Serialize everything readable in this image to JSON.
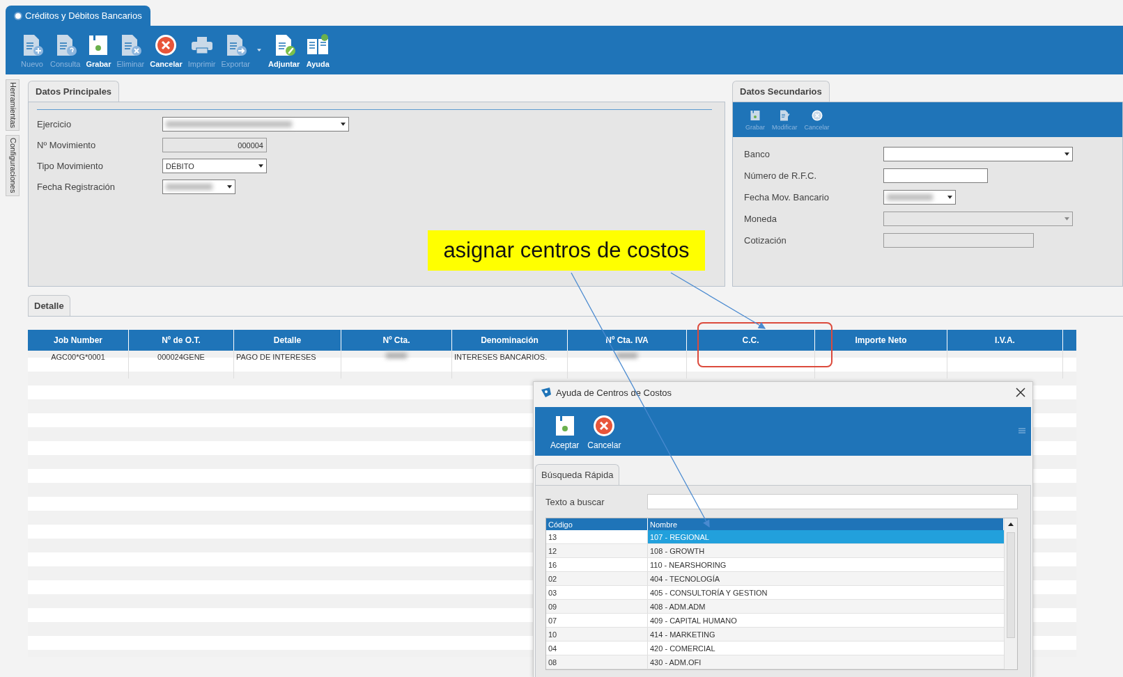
{
  "window": {
    "tab": "Créditos y Débitos Bancarios"
  },
  "side_tabs": [
    "Herramientas",
    "Configuraciones"
  ],
  "toolbar": [
    {
      "kind": "new",
      "label": "Nuevo",
      "disabled": true
    },
    {
      "kind": "query",
      "label": "Consulta",
      "disabled": true
    },
    {
      "kind": "save",
      "label": "Grabar",
      "disabled": false
    },
    {
      "kind": "delete",
      "label": "Eliminar",
      "disabled": true
    },
    {
      "kind": "cancel",
      "label": "Cancelar",
      "disabled": false
    },
    {
      "kind": "print",
      "label": "Imprimir",
      "disabled": true
    },
    {
      "kind": "export",
      "label": "Exportar",
      "disabled": true
    },
    {
      "kind": "attach",
      "label": "Adjuntar",
      "disabled": false
    },
    {
      "kind": "help",
      "label": "Ayuda",
      "disabled": false
    }
  ],
  "main_panel": {
    "tab": "Datos Principales",
    "fields": [
      {
        "label": "Ejercicio",
        "kind": "dropdown",
        "redacted": true,
        "disabled": false
      },
      {
        "label": "Nº Movimiento",
        "kind": "number",
        "value": "000004",
        "disabled": true
      },
      {
        "label": "Tipo Movimiento",
        "kind": "dropdown",
        "value": "DÉBITO",
        "disabled": false
      },
      {
        "label": "Fecha Registración",
        "kind": "dropdown",
        "redacted": true,
        "disabled": false
      }
    ]
  },
  "secondary_panel": {
    "tab": "Datos Secundarios",
    "toolbar": [
      {
        "kind": "save",
        "label": "Grabar",
        "disabled": true
      },
      {
        "kind": "modify",
        "label": "Modificar",
        "disabled": true
      },
      {
        "kind": "cancel",
        "label": "Cancelar",
        "disabled": true
      }
    ],
    "fields": [
      {
        "label": "Banco",
        "kind": "dropdown",
        "disabled": false
      },
      {
        "label": "Número de R.F.C.",
        "kind": "text",
        "disabled": false
      },
      {
        "label": "Fecha Mov. Bancario",
        "kind": "dropdown",
        "redacted": true,
        "disabled": false
      },
      {
        "label": "Moneda",
        "kind": "dropdown",
        "disabled": true
      },
      {
        "label": "Cotización",
        "kind": "text",
        "disabled": true
      }
    ]
  },
  "detail": {
    "tab": "Detalle",
    "columns": [
      "Job Number",
      "Nº de O.T.",
      "Detalle",
      "Nº Cta.",
      "Denominación",
      "Nº Cta. IVA",
      "C.C.",
      "Importe Neto",
      "I.V.A."
    ],
    "rows": [
      {
        "cells": [
          {
            "text": "AGC00*G*0001"
          },
          {
            "text": "000024GENE"
          },
          {
            "text": "PAGO DE INTERESES"
          },
          {
            "redacted": true
          },
          {
            "text": "INTERESES BANCARIOS."
          },
          {
            "redacted": true
          },
          {},
          {},
          {}
        ]
      }
    ]
  },
  "dialog": {
    "title": "Ayuda de Centros de Costos",
    "toolbar": [
      {
        "kind": "save",
        "label": "Aceptar",
        "disabled": false
      },
      {
        "kind": "cancel",
        "label": "Cancelar",
        "disabled": false
      }
    ],
    "tab": "Búsqueda Rápida",
    "search_label": "Texto a buscar",
    "columns": [
      "Código",
      "Nombre"
    ],
    "rows": [
      {
        "code": "13",
        "name": "107 - REGIONAL",
        "selected": true
      },
      {
        "code": "12",
        "name": "108 - GROWTH",
        "selected": false
      },
      {
        "code": "16",
        "name": "110 - NEARSHORING",
        "selected": false
      },
      {
        "code": "02",
        "name": "404 - TECNOLOGÍA",
        "selected": false
      },
      {
        "code": "03",
        "name": "405 - CONSULTORÍA Y GESTION",
        "selected": false
      },
      {
        "code": "09",
        "name": "408 - ADM.ADM",
        "selected": false
      },
      {
        "code": "07",
        "name": "409 - CAPITAL HUMANO",
        "selected": false
      },
      {
        "code": "10",
        "name": "414 - MARKETING",
        "selected": false
      },
      {
        "code": "04",
        "name": "420 - COMERCIAL",
        "selected": false
      },
      {
        "code": "08",
        "name": "430 - ADM.OFI",
        "selected": false
      }
    ]
  },
  "annotation": {
    "callout": "asignar centros de costos"
  }
}
